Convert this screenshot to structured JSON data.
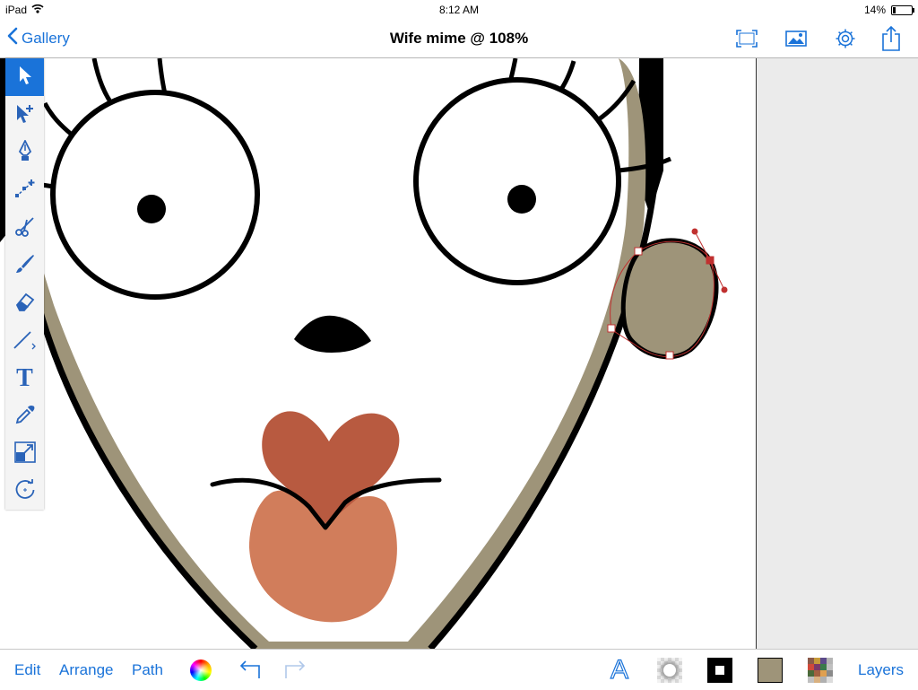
{
  "status_bar": {
    "device": "iPad",
    "wifi_icon": "wifi-icon",
    "time": "8:12 AM",
    "battery_percent": "14%",
    "battery_level": 0.14
  },
  "nav": {
    "back_label": "Gallery",
    "title": "Wife mime @ 108%",
    "icons": [
      "fullscreen-icon",
      "image-icon",
      "settings-gear-icon",
      "share-icon"
    ]
  },
  "toolbox": {
    "tools": [
      "select-arrow-icon",
      "direct-select-icon",
      "pen-icon",
      "add-node-icon",
      "scissors-icon",
      "brush-icon",
      "eraser-icon",
      "line-icon",
      "text-tool-icon",
      "eyedropper-icon",
      "scale-icon",
      "rotate-icon"
    ],
    "text_tool_glyph": "T",
    "active_tool": "select-arrow-icon"
  },
  "bottom_bar": {
    "edit_label": "Edit",
    "arrange_label": "Arrange",
    "path_label": "Path",
    "layers_label": "Layers",
    "text_style_glyph": "A",
    "icons": [
      "color-wheel-icon",
      "undo-icon",
      "redo-icon",
      "text-style-icon",
      "shadow-icon",
      "stroke-swatch-icon",
      "fill-swatch-icon",
      "pattern-icon"
    ]
  },
  "colors": {
    "accent": "#1a73d9",
    "fill_swatch": "#9e9479",
    "stroke_swatch": "#000000",
    "skin_outline": "#9e9479",
    "lip_top": "#b85a40",
    "lip_bottom": "#d17d5b",
    "selection": "#c0302f",
    "side_panel": "#ebebeb"
  }
}
